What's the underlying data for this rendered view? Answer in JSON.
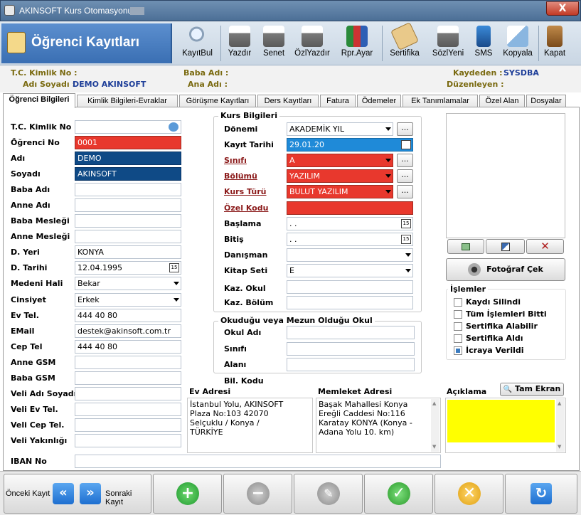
{
  "window": {
    "title": "AKINSOFT Kurs Otomasyonu s",
    "close": "X"
  },
  "header": {
    "title": "Öğrenci Kayıtları"
  },
  "toolbar": [
    {
      "label": "KayıtBul",
      "icon": "magnifier-icon"
    },
    {
      "label": "Yazdır",
      "icon": "printer-icon"
    },
    {
      "label": "Senet",
      "icon": "printer-icon"
    },
    {
      "label": "ÖzlYazdır",
      "icon": "printer-icon"
    },
    {
      "label": "Rpr.Ayar",
      "icon": "books-icon"
    },
    {
      "label": "Sertifika",
      "icon": "scroll-icon"
    },
    {
      "label": "SözlYeni",
      "icon": "printer-icon"
    },
    {
      "label": "SMS",
      "icon": "phone-icon"
    },
    {
      "label": "Kopyala",
      "icon": "copy-icon"
    },
    {
      "label": "Kapat",
      "icon": "door-icon"
    }
  ],
  "info": {
    "tc_label": "T.C. Kimlik No :",
    "tc_value": "",
    "name_label": "Adı Soyadı :",
    "name_value": "DEMO AKINSOFT",
    "father_label": "Baba Adı :",
    "mother_label": "Ana Adı :",
    "recorder_label": "Kaydeden :",
    "recorder_value": "SYSDBA",
    "editor_label": "Düzenleyen :",
    "editor_value": ""
  },
  "tabs": [
    "Öğrenci Bilgileri",
    "Kimlik Bilgileri-Evraklar",
    "Görüşme Kayıtları",
    "Ders Kayıtları",
    "Fatura",
    "Ödemeler",
    "Ek Tanımlamalar",
    "Özel Alan",
    "Dosyalar"
  ],
  "student": {
    "tc_label": "T.C. Kimlik No",
    "tc": "",
    "no_label": "Öğrenci No",
    "no": "0001",
    "name_label": "Adı",
    "name": "DEMO",
    "surname_label": "Soyadı",
    "surname": "AKINSOFT",
    "father_label": "Baba Adı",
    "father": "",
    "mother_label": "Anne Adı",
    "mother": "",
    "father_job_label": "Baba Mesleği",
    "father_job": "",
    "mother_job_label": "Anne Mesleği",
    "mother_job": "",
    "birthplace_label": "D. Yeri",
    "birthplace": "KONYA",
    "birthdate_label": "D. Tarihi",
    "birthdate": "12.04.1995",
    "marital_label": "Medeni Hali",
    "marital": "Bekar",
    "gender_label": "Cinsiyet",
    "gender": "Erkek",
    "home_tel_label": "Ev Tel.",
    "home_tel": "444 40 80",
    "email_label": "EMail",
    "email": "destek@akinsoft.com.tr",
    "mobile_label": "Cep Tel",
    "mobile": "444 40 80",
    "mother_gsm_label": "Anne GSM",
    "mother_gsm": "",
    "father_gsm_label": "Baba GSM",
    "father_gsm": "",
    "guardian_name_label": "Veli Adı Soyadı",
    "guardian_name": "",
    "guardian_home_label": "Veli Ev Tel.",
    "guardian_home": "",
    "guardian_mobile_label": "Veli Cep Tel.",
    "guardian_mobile": "",
    "guardian_rel_label": "Veli Yakınlığı",
    "guardian_rel": "",
    "iban_label": "IBAN No",
    "iban": ""
  },
  "course": {
    "group_title": "Kurs Bilgileri",
    "term_label": "Dönemi",
    "term": "AKADEMİK YIL",
    "reg_date_label": "Kayıt Tarihi",
    "reg_date": "29.01.20",
    "class_label": "Sınıfı",
    "class": "A",
    "dept_label": "Bölümü",
    "dept": "YAZILIM",
    "type_label": "Kurs Türü",
    "type": "BULUT YAZILIM",
    "code_label": "Özel Kodu",
    "code": "",
    "start_label": "Başlama",
    "start": " .  .",
    "end_label": "Bitiş",
    "end": " .  .",
    "advisor_label": "Danışman",
    "advisor": "",
    "book_label": "Kitap Seti",
    "book": "E",
    "reg_school_label": "Kaz. Okul",
    "reg_school": "",
    "reg_dept_label": "Kaz. Bölüm",
    "reg_dept": ""
  },
  "school": {
    "group_title": "Okuduğu veya Mezun Olduğu Okul",
    "school_label": "Okul Adı",
    "school": "",
    "class_label": "Sınıfı",
    "class": "",
    "field_label": "Alanı",
    "field": "",
    "code_label": "Bil. Kodu"
  },
  "photo": {
    "button": "Fotoğraf Çek"
  },
  "operations": {
    "title": "İşlemler",
    "items": [
      {
        "label": "Kaydı Silindi",
        "checked": false
      },
      {
        "label": "Tüm İşlemleri Bitti",
        "checked": false
      },
      {
        "label": "Sertifika Alabilir",
        "checked": false
      },
      {
        "label": "Sertifika Aldı",
        "checked": false
      },
      {
        "label": "İcraya Verildi",
        "checked": true
      }
    ]
  },
  "addresses": {
    "home_label": "Ev Adresi",
    "home": "İstanbul Yolu, AKINSOFT\nPlaza No:103 42070\nSelçuklu / Konya /\nTÜRKİYE",
    "hometown_label": "Memleket Adresi",
    "hometown": "Başak Mahallesi Konya\nEreğli Caddesi No:116\nKaratay KONYA (Konya -\nAdana Yolu 10. km)",
    "note_label": "Açıklama",
    "note": "",
    "fullscreen": "Tam Ekran"
  },
  "bottom": {
    "prev": "Önceki Kayıt",
    "next": "Sonraki Kayıt"
  },
  "colors": {
    "accent": "#3a6fb3",
    "required": "#e8382d",
    "name_field": "#0f4a86",
    "date_field": "#1f8ad8",
    "note_bg": "#ffff00"
  }
}
